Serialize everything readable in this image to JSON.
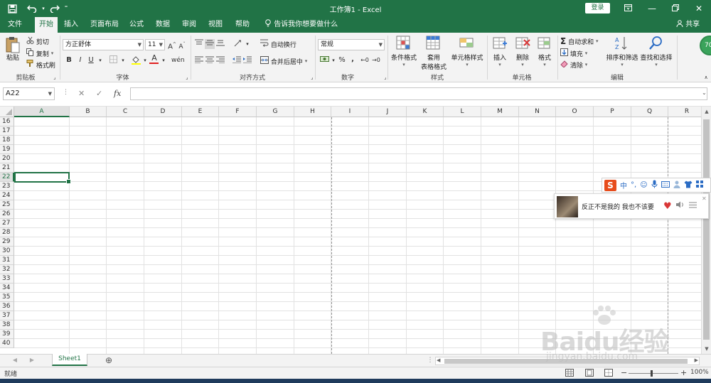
{
  "titlebar": {
    "title": "工作簿1  -  Excel",
    "login": "登录"
  },
  "menu": {
    "tabs": [
      "文件",
      "开始",
      "插入",
      "页面布局",
      "公式",
      "数据",
      "审阅",
      "视图",
      "帮助"
    ],
    "active": "开始",
    "tell_me": "告诉我你想要做什么",
    "share": "共享"
  },
  "ribbon": {
    "clipboard": {
      "paste": "粘贴",
      "cut": "剪切",
      "copy": "复制",
      "format_painter": "格式刷",
      "label": "剪贴板"
    },
    "font": {
      "name": "方正舒体",
      "size": "11",
      "bold": "B",
      "italic": "I",
      "underline": "U",
      "label": "字体"
    },
    "alignment": {
      "wrap": "自动换行",
      "merge": "合并后居中",
      "label": "对齐方式"
    },
    "number": {
      "format": "常规",
      "percent": "%",
      "comma": ",",
      "label": "数字"
    },
    "styles": {
      "conditional": "条件格式",
      "table_line1": "套用",
      "table_line2": "表格格式",
      "cell_styles": "单元格样式",
      "label": "样式"
    },
    "cells": {
      "insert": "插入",
      "delete": "删除",
      "format": "格式",
      "label": "单元格"
    },
    "editing": {
      "autosum": "自动求和",
      "fill": "填充",
      "clear": "清除",
      "sort_filter": "排序和筛选",
      "find_select": "查找和选择",
      "label": "编辑"
    },
    "badge": "70"
  },
  "formula_bar": {
    "name_box": "A22",
    "fx": "fx",
    "formula": ""
  },
  "grid": {
    "columns": [
      "A",
      "B",
      "C",
      "D",
      "E",
      "F",
      "G",
      "H",
      "I",
      "J",
      "K",
      "L",
      "M",
      "N",
      "O",
      "P",
      "Q",
      "R"
    ],
    "rows": [
      "16",
      "17",
      "18",
      "19",
      "20",
      "21",
      "22",
      "23",
      "24",
      "25",
      "26",
      "27",
      "28",
      "29",
      "30",
      "31",
      "32",
      "33",
      "34",
      "35",
      "36",
      "37",
      "38",
      "39",
      "40"
    ],
    "selected_row": "22",
    "selected_column": "A"
  },
  "sheets": {
    "tabs": [
      "Sheet1"
    ],
    "add": "⊕"
  },
  "status": {
    "ready": "就绪",
    "zoom": "100%"
  },
  "ime": {
    "logo": "S",
    "mode": "中"
  },
  "music": {
    "song": "反正不是我的  我也不该要"
  },
  "watermark": {
    "brand": "Baidu经验",
    "url": "jingyan.baidu.com"
  }
}
